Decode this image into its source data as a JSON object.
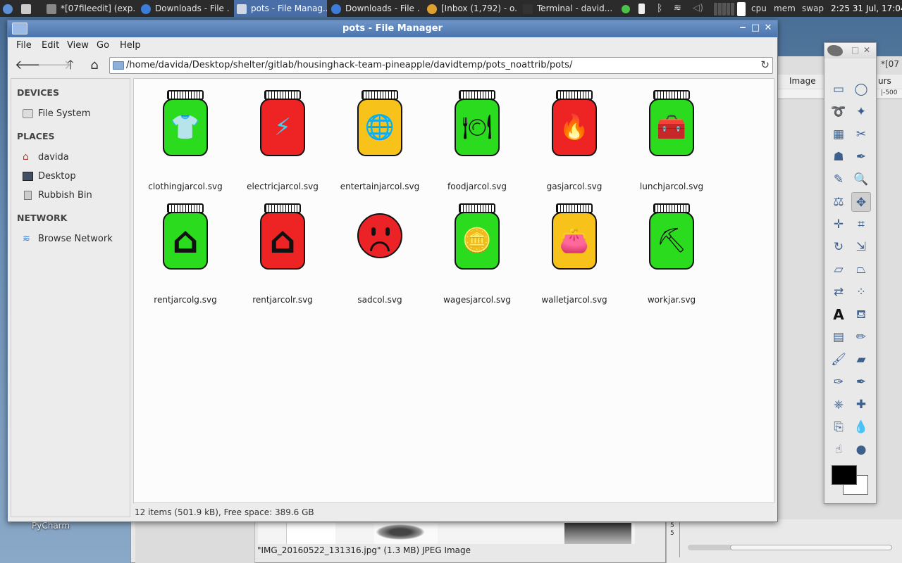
{
  "taskbar": {
    "tasks": [
      {
        "label": "*[07fileedit] (exp...",
        "icon": "gimp-icon"
      },
      {
        "label": "Downloads - File ...",
        "icon": "download-icon"
      },
      {
        "label": "pots - File Manag...",
        "icon": "folder-icon",
        "active": true
      },
      {
        "label": "Downloads - File ...",
        "icon": "download-icon"
      },
      {
        "label": "[Inbox (1,792) - o...",
        "icon": "chrome-icon"
      },
      {
        "label": "Terminal - david...",
        "icon": "terminal-icon"
      }
    ],
    "tray": {
      "cpu": "cpu",
      "mem": "mem",
      "swap": "swap"
    },
    "clock": "2:25  31 Jul, 17:04"
  },
  "window": {
    "title": "pots - File Manager"
  },
  "menubar": [
    "File",
    "Edit",
    "View",
    "Go",
    "Help"
  ],
  "location": {
    "path": "/home/davida/Desktop/shelter/gitlab/housinghack-team-pineapple/davidtemp/pots_noattrib/pots/"
  },
  "sidebar": {
    "devices_heading": "DEVICES",
    "devices": [
      {
        "label": "File System",
        "icon": "drive-icon"
      }
    ],
    "places_heading": "PLACES",
    "places": [
      {
        "label": "davida",
        "icon": "home-icon"
      },
      {
        "label": "Desktop",
        "icon": "desktop-icon"
      },
      {
        "label": "Rubbish Bin",
        "icon": "trash-icon"
      }
    ],
    "network_heading": "NETWORK",
    "network": [
      {
        "label": "Browse Network",
        "icon": "wifi-icon"
      }
    ]
  },
  "files": [
    {
      "name": "clothingjarcol.svg",
      "kind": "jar",
      "color": "#2bdb1e",
      "glyph": "clothing-icon"
    },
    {
      "name": "electricjarcol.svg",
      "kind": "jar",
      "color": "#ee2323",
      "glyph": "lightning-icon"
    },
    {
      "name": "entertainjarcol.svg",
      "kind": "jar",
      "color": "#f7c21a",
      "glyph": "globe-icon"
    },
    {
      "name": "foodjarcol.svg",
      "kind": "jar",
      "color": "#2bdb1e",
      "glyph": "plate-icon"
    },
    {
      "name": "gasjarcol.svg",
      "kind": "jar",
      "color": "#ee2323",
      "glyph": "flame-icon"
    },
    {
      "name": "lunchjarcol.svg",
      "kind": "jar",
      "color": "#2bdb1e",
      "glyph": "lunchbox-icon"
    },
    {
      "name": "rentjarcolg.svg",
      "kind": "jar",
      "color": "#2bdb1e",
      "glyph": "house-icon"
    },
    {
      "name": "rentjarcolr.svg",
      "kind": "jar",
      "color": "#ee2323",
      "glyph": "house-icon"
    },
    {
      "name": "sadcol.svg",
      "kind": "sad",
      "color": "#ec2326",
      "glyph": "sad-face-icon"
    },
    {
      "name": "wagesjarcol.svg",
      "kind": "jar",
      "color": "#2bdb1e",
      "glyph": "coins-hand-icon"
    },
    {
      "name": "walletjarcol.svg",
      "kind": "jar",
      "color": "#f7c21a",
      "glyph": "wallet-icon"
    },
    {
      "name": "workjar.svg",
      "kind": "jar",
      "color": "#2bdb1e",
      "glyph": "worker-icon"
    }
  ],
  "status": "12 items (501.9 kB), Free space: 389.6 GB",
  "background": {
    "desktop_label": "PyCharm",
    "image_status": "\"IMG_20160522_131316.jpg\" (1.3 MB) JPEG Image",
    "gimp_menu_image": "Image",
    "gimp_title_fragment": "*[07",
    "gimp_menu_fragment": "urs",
    "gimp_ruler": "|-500",
    "ruler_marks": "5\n5"
  }
}
